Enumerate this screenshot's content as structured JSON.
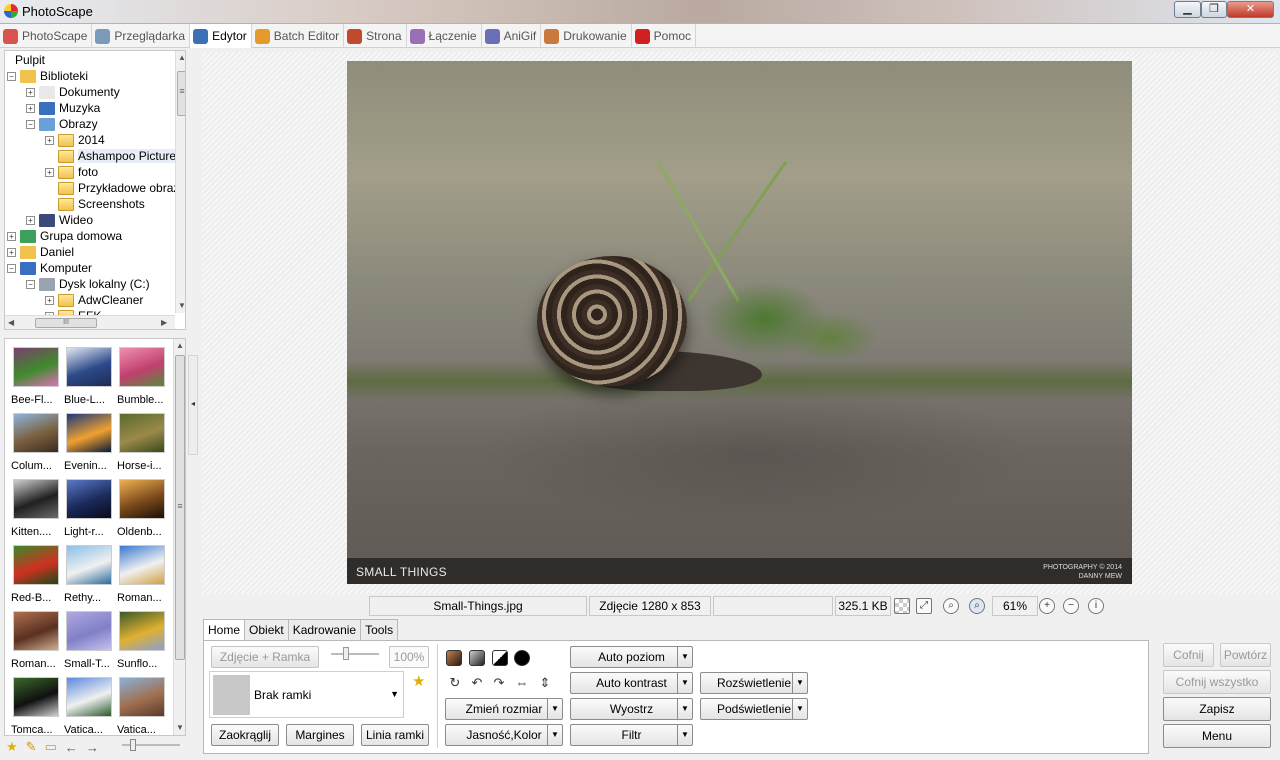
{
  "window": {
    "title": "PhotoScape",
    "min": "▁",
    "max": "❐",
    "close": "✕"
  },
  "menu": [
    {
      "label": "PhotoScape",
      "icon": "photoscape-icon",
      "color": "#d9534f"
    },
    {
      "label": "Przeglądarka",
      "icon": "browser-icon",
      "color": "#7a9ab8"
    },
    {
      "label": "Edytor",
      "icon": "editor-icon",
      "color": "#3b6fb6"
    },
    {
      "label": "Batch Editor",
      "icon": "batch-editor-icon",
      "color": "#e59a2b"
    },
    {
      "label": "Strona",
      "icon": "page-icon",
      "color": "#c04a2e"
    },
    {
      "label": "Łączenie",
      "icon": "combine-icon",
      "color": "#9b6fb5"
    },
    {
      "label": "AniGif",
      "icon": "anigif-icon",
      "color": "#6b6fb6"
    },
    {
      "label": "Drukowanie",
      "icon": "print-icon",
      "color": "#c9793b"
    },
    {
      "label": "Pomoc",
      "icon": "help-icon",
      "color": "#d02020"
    }
  ],
  "tree": {
    "items": [
      {
        "label": "Pulpit",
        "depth": 0,
        "icon": "none"
      },
      {
        "label": "Biblioteki",
        "depth": 0,
        "icon": "library-icon",
        "exp": "−"
      },
      {
        "label": "Dokumenty",
        "depth": 1,
        "icon": "documents-icon",
        "exp": "+"
      },
      {
        "label": "Muzyka",
        "depth": 1,
        "icon": "music-icon",
        "exp": "+"
      },
      {
        "label": "Obrazy",
        "depth": 1,
        "icon": "pictures-icon",
        "exp": "−"
      },
      {
        "label": "2014",
        "depth": 2,
        "icon": "folder-icon",
        "exp": "+"
      },
      {
        "label": "Ashampoo Picture",
        "depth": 2,
        "icon": "folder-icon",
        "exp": "",
        "selected": true
      },
      {
        "label": "foto",
        "depth": 2,
        "icon": "folder-icon",
        "exp": "+"
      },
      {
        "label": "Przykładowe obraz",
        "depth": 2,
        "icon": "folder-icon",
        "exp": ""
      },
      {
        "label": "Screenshots",
        "depth": 2,
        "icon": "folder-icon",
        "exp": ""
      },
      {
        "label": "Wideo",
        "depth": 1,
        "icon": "video-icon",
        "exp": "+"
      },
      {
        "label": "Grupa domowa",
        "depth": 0,
        "icon": "homegroup-icon",
        "exp": "+"
      },
      {
        "label": "Daniel",
        "depth": 0,
        "icon": "user-folder-icon",
        "exp": "+"
      },
      {
        "label": "Komputer",
        "depth": 0,
        "icon": "computer-icon",
        "exp": "−"
      },
      {
        "label": "Dysk lokalny (C:)",
        "depth": 1,
        "icon": "drive-icon",
        "exp": "−"
      },
      {
        "label": "AdwCleaner",
        "depth": 2,
        "icon": "folder-icon",
        "exp": "+"
      },
      {
        "label": "EFK",
        "depth": 2,
        "icon": "folder-icon",
        "exp": "+"
      }
    ],
    "hscroll_grip": "III",
    "vscroll_grip": "≡"
  },
  "thumbnails": [
    {
      "caption": "Bee-Fl...",
      "colors": [
        "#7a3f6e",
        "#3f8b2c",
        "#e070b8"
      ]
    },
    {
      "caption": "Blue-L...",
      "colors": [
        "#dfe8f0",
        "#2d4a8a",
        "#1e2a55"
      ]
    },
    {
      "caption": "Bumble...",
      "colors": [
        "#f090b0",
        "#c04070",
        "#5a8a3a"
      ]
    },
    {
      "caption": "Colum...",
      "colors": [
        "#8fb4d8",
        "#7a6040",
        "#3b2b1f"
      ]
    },
    {
      "caption": "Evenin...",
      "colors": [
        "#1a3a7a",
        "#f0a030",
        "#0a1a3a"
      ]
    },
    {
      "caption": "Horse-i...",
      "colors": [
        "#5a6a2a",
        "#9a8a4a",
        "#3a4a1a"
      ]
    },
    {
      "caption": "Kitten....",
      "colors": [
        "#cfcfcf",
        "#202020",
        "#6a6a6a"
      ]
    },
    {
      "caption": "Light-r...",
      "colors": [
        "#5a7ac8",
        "#1a2a5a",
        "#0a0a1a"
      ]
    },
    {
      "caption": "Oldenb...",
      "colors": [
        "#f0b050",
        "#7a4a1a",
        "#1a1008"
      ]
    },
    {
      "caption": "Red-B...",
      "colors": [
        "#3a8a2a",
        "#d03020",
        "#1a4a1a"
      ]
    },
    {
      "caption": "Rethy...",
      "colors": [
        "#8ac0e8",
        "#f0f0f0",
        "#2a6a9a"
      ]
    },
    {
      "caption": "Roman...",
      "colors": [
        "#3a7ad0",
        "#f0f0f0",
        "#d0a040"
      ]
    },
    {
      "caption": "Roman...",
      "colors": [
        "#b07050",
        "#5a3020",
        "#d0b090"
      ]
    },
    {
      "caption": "Small-T...",
      "colors": [
        "#b0a8e0",
        "#8080c8",
        "#c8c0f0"
      ]
    },
    {
      "caption": "Sunflo...",
      "colors": [
        "#3a5a2a",
        "#e0b030",
        "#8aa0d0"
      ]
    },
    {
      "caption": "Tomca...",
      "colors": [
        "#3a6a2a",
        "#101010",
        "#d0d0d0"
      ]
    },
    {
      "caption": "Vatica...",
      "colors": [
        "#5a8ae0",
        "#f0f0f0",
        "#2a5a2a"
      ]
    },
    {
      "caption": "Vatica...",
      "colors": [
        "#8ab0d8",
        "#a07050",
        "#5a3a2a"
      ]
    }
  ],
  "photo": {
    "caption_left": "SMALL THINGS",
    "caption_right_line1": "PHOTOGRAPHY © 2014",
    "caption_right_line2": "DANNY MEW"
  },
  "status": {
    "filename": "Small-Things.jpg",
    "dimensions": "Zdjęcie 1280 x 853",
    "empty": "",
    "filesize": "325.1 KB",
    "zoom": "61%"
  },
  "editor": {
    "tabs": [
      "Home",
      "Obiekt",
      "Kadrowanie",
      "Tools"
    ],
    "photo_frame_button": "Zdjęcie + Ramka",
    "opacity": "100%",
    "frame_name": "Brak ramki",
    "buttons": {
      "round": "Zaokrąglij",
      "margins": "Margines",
      "frame_line": "Linia ramki",
      "resize": "Zmień rozmiar",
      "brightness_color": "Jasność,Kolor",
      "auto_level": "Auto poziom",
      "auto_contrast": "Auto kontrast",
      "sharpen": "Wyostrz",
      "filter": "Filtr",
      "bloom": "Rozświetlenie",
      "backlight": "Podświetlenie"
    }
  },
  "actions": {
    "undo": "Cofnij",
    "redo": "Powtórz",
    "undo_all": "Cofnij wszystko",
    "save": "Zapisz",
    "menu": "Menu"
  }
}
